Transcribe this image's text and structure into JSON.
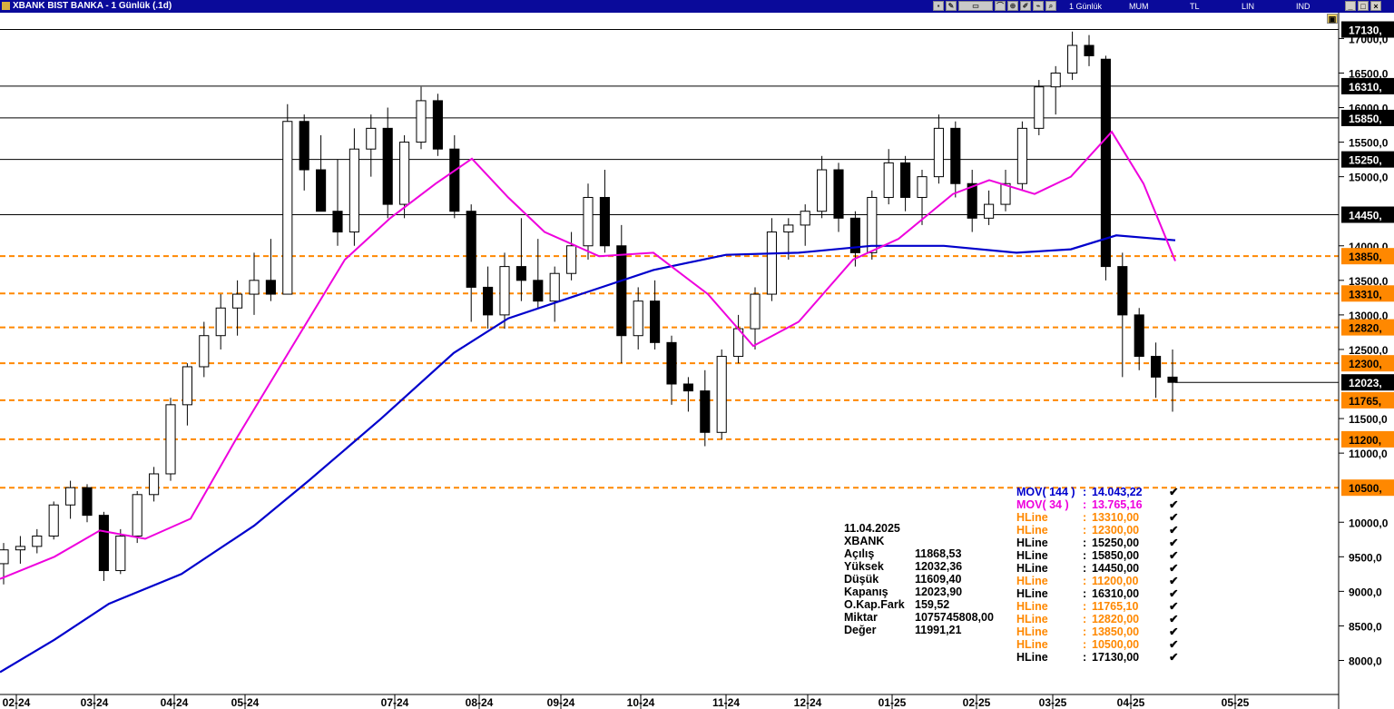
{
  "window": {
    "title": "XBANK BIST BANKA - 1 Günlük (.1d)",
    "toolbar": {
      "period": "1 Günlük",
      "mode": "MUM",
      "currency": "TL",
      "scale": "LIN",
      "indicator": "IND"
    }
  },
  "chart_data": {
    "type": "candlestick",
    "symbol": "XBANK",
    "x_ticks": [
      "02-24",
      "03-24",
      "04-24",
      "05-24",
      "07-24",
      "08-24",
      "09-24",
      "10-24",
      "11-24",
      "12-24",
      "01-25",
      "02-25",
      "03-25",
      "04-25",
      "05-25"
    ],
    "y_ticks": [
      "17000,0",
      "16500,0",
      "16000,0",
      "15500,0",
      "15000,0",
      "14000,0",
      "13500,0",
      "13000,0",
      "12500,0",
      "11500,0",
      "11000,0",
      "10000,0",
      "9500,0",
      "9000,0",
      "8500,0",
      "8000,0"
    ],
    "ylim": [
      7700,
      17400
    ],
    "ohlc_daily_approx": [
      [
        9400,
        9700,
        9100,
        9600
      ],
      [
        9600,
        9800,
        9400,
        9650
      ],
      [
        9650,
        9900,
        9550,
        9800
      ],
      [
        9800,
        10300,
        9750,
        10250
      ],
      [
        10250,
        10600,
        10050,
        10500
      ],
      [
        10500,
        10550,
        10000,
        10100
      ],
      [
        10100,
        10150,
        9150,
        9300
      ],
      [
        9300,
        9900,
        9250,
        9800
      ],
      [
        9800,
        10450,
        9700,
        10400
      ],
      [
        10400,
        10800,
        10300,
        10700
      ],
      [
        10700,
        11800,
        10600,
        11700
      ],
      [
        11700,
        12300,
        11400,
        12250
      ],
      [
        12250,
        12900,
        12100,
        12700
      ],
      [
        12700,
        13300,
        12500,
        13100
      ],
      [
        13100,
        13500,
        12700,
        13300
      ],
      [
        13300,
        13900,
        13000,
        13500
      ],
      [
        13500,
        14100,
        13200,
        13300
      ],
      [
        13300,
        16050,
        13300,
        15800
      ],
      [
        15800,
        15900,
        14800,
        15100
      ],
      [
        15100,
        15600,
        14600,
        14500
      ],
      [
        14500,
        15250,
        14000,
        14200
      ],
      [
        14200,
        15700,
        14000,
        15400
      ],
      [
        15400,
        15900,
        15000,
        15700
      ],
      [
        15700,
        16000,
        14400,
        14600
      ],
      [
        14600,
        15600,
        14400,
        15500
      ],
      [
        15500,
        16300,
        15400,
        16100
      ],
      [
        16100,
        16200,
        15300,
        15400
      ],
      [
        15400,
        15600,
        14400,
        14500
      ],
      [
        14500,
        14600,
        12900,
        13400
      ],
      [
        13400,
        13700,
        12800,
        13000
      ],
      [
        13000,
        13900,
        12800,
        13700
      ],
      [
        13700,
        14400,
        13200,
        13500
      ],
      [
        13500,
        14100,
        13100,
        13200
      ],
      [
        13200,
        13700,
        12900,
        13600
      ],
      [
        13600,
        14200,
        13500,
        14000
      ],
      [
        14000,
        14900,
        13800,
        14700
      ],
      [
        14700,
        15100,
        13900,
        14000
      ],
      [
        14000,
        14300,
        12300,
        12700
      ],
      [
        12700,
        13400,
        12500,
        13200
      ],
      [
        13200,
        13500,
        12500,
        12600
      ],
      [
        12600,
        12700,
        11700,
        12000
      ],
      [
        12000,
        12100,
        11600,
        11900
      ],
      [
        11900,
        12200,
        11100,
        11300
      ],
      [
        11300,
        12500,
        11200,
        12400
      ],
      [
        12400,
        13000,
        12300,
        12800
      ],
      [
        12800,
        13400,
        12500,
        13300
      ],
      [
        13300,
        14400,
        13200,
        14200
      ],
      [
        14200,
        14400,
        13800,
        14300
      ],
      [
        14300,
        14600,
        14000,
        14500
      ],
      [
        14500,
        15300,
        14400,
        15100
      ],
      [
        15100,
        15200,
        14200,
        14400
      ],
      [
        14400,
        14500,
        13700,
        13900
      ],
      [
        13900,
        14800,
        13800,
        14700
      ],
      [
        14700,
        15400,
        14600,
        15200
      ],
      [
        15200,
        15300,
        14500,
        14700
      ],
      [
        14700,
        15100,
        14300,
        15000
      ],
      [
        15000,
        15900,
        14900,
        15700
      ],
      [
        15700,
        15800,
        14700,
        14900
      ],
      [
        14900,
        15100,
        14200,
        14400
      ],
      [
        14400,
        14800,
        14300,
        14600
      ],
      [
        14600,
        15100,
        14500,
        14900
      ],
      [
        14900,
        15800,
        14800,
        15700
      ],
      [
        15700,
        16400,
        15600,
        16300
      ],
      [
        16300,
        16600,
        15900,
        16500
      ],
      [
        16500,
        17100,
        16400,
        16900
      ],
      [
        16900,
        17050,
        16600,
        16750
      ],
      [
        16700,
        16750,
        13500,
        13700
      ],
      [
        13700,
        13900,
        12100,
        13000
      ],
      [
        13000,
        13100,
        12200,
        12400
      ],
      [
        12400,
        12600,
        11800,
        12100
      ],
      [
        12100,
        12500,
        11600,
        12024
      ]
    ],
    "close_last": "12023,",
    "moving_averages": [
      {
        "name": "MOV( 144 )",
        "value": "14.043,22",
        "color": "#0000cc"
      },
      {
        "name": "MOV( 34 )",
        "value": "13.765,16",
        "color": "#ee00dd"
      }
    ],
    "ma144_approx": [
      [
        0,
        7830
      ],
      [
        60,
        8300
      ],
      [
        120,
        8820
      ],
      [
        200,
        9250
      ],
      [
        280,
        9950
      ],
      [
        340,
        10600
      ],
      [
        420,
        11500
      ],
      [
        500,
        12450
      ],
      [
        560,
        12950
      ],
      [
        640,
        13300
      ],
      [
        720,
        13650
      ],
      [
        800,
        13870
      ],
      [
        880,
        13900
      ],
      [
        960,
        14000
      ],
      [
        1040,
        14000
      ],
      [
        1120,
        13900
      ],
      [
        1180,
        13950
      ],
      [
        1230,
        14150
      ],
      [
        1295,
        14080
      ]
    ],
    "ma34_approx": [
      [
        0,
        9180
      ],
      [
        60,
        9500
      ],
      [
        110,
        9880
      ],
      [
        160,
        9760
      ],
      [
        210,
        10050
      ],
      [
        260,
        11200
      ],
      [
        320,
        12500
      ],
      [
        380,
        13800
      ],
      [
        430,
        14400
      ],
      [
        480,
        14900
      ],
      [
        520,
        15260
      ],
      [
        560,
        14700
      ],
      [
        600,
        14200
      ],
      [
        660,
        13850
      ],
      [
        720,
        13900
      ],
      [
        780,
        13300
      ],
      [
        830,
        12550
      ],
      [
        880,
        12900
      ],
      [
        940,
        13800
      ],
      [
        990,
        14100
      ],
      [
        1050,
        14750
      ],
      [
        1090,
        14950
      ],
      [
        1140,
        14750
      ],
      [
        1180,
        15000
      ],
      [
        1225,
        15650
      ],
      [
        1260,
        14900
      ],
      [
        1295,
        13780
      ]
    ],
    "hlines": [
      {
        "label": "HLine",
        "value": "13310,00",
        "box": "13310,",
        "color": "#ff8800",
        "style": "dashed"
      },
      {
        "label": "HLine",
        "value": "12300,00",
        "box": "12300,",
        "color": "#ff8800",
        "style": "dashed"
      },
      {
        "label": "HLine",
        "value": "15250,00",
        "box": "15250,",
        "color": "#000000",
        "style": "solid"
      },
      {
        "label": "HLine",
        "value": "15850,00",
        "box": "15850,",
        "color": "#000000",
        "style": "solid"
      },
      {
        "label": "HLine",
        "value": "14450,00",
        "box": "14450,",
        "color": "#000000",
        "style": "solid"
      },
      {
        "label": "HLine",
        "value": "11200,00",
        "box": "11200,",
        "color": "#ff8800",
        "style": "dashed"
      },
      {
        "label": "HLine",
        "value": "16310,00",
        "box": "16310,",
        "color": "#000000",
        "style": "solid"
      },
      {
        "label": "HLine",
        "value": "11765,10",
        "box": "11765,",
        "color": "#ff8800",
        "style": "dashed"
      },
      {
        "label": "HLine",
        "value": "12820,00",
        "box": "12820,",
        "color": "#ff8800",
        "style": "dashed"
      },
      {
        "label": "HLine",
        "value": "13850,00",
        "box": "13850,",
        "color": "#ff8800",
        "style": "dashed"
      },
      {
        "label": "HLine",
        "value": "10500,00",
        "box": "10500,",
        "color": "#ff8800",
        "style": "dashed"
      },
      {
        "label": "HLine",
        "value": "17130,00",
        "box": "17130,",
        "color": "#000000",
        "style": "solid"
      }
    ],
    "info": {
      "date": "11.04.2025",
      "symbol": "XBANK",
      "rows": [
        {
          "k": "Açılış",
          "v": "11868,53"
        },
        {
          "k": "Yüksek",
          "v": "12032,36"
        },
        {
          "k": "Düşük",
          "v": "11609,40"
        },
        {
          "k": "Kapanış",
          "v": "12023,90"
        },
        {
          "k": "O.Kap.Fark",
          "v": "159,52"
        },
        {
          "k": "Miktar",
          "v": "1075745808,00"
        },
        {
          "k": "Değer",
          "v": "11991,21"
        }
      ]
    },
    "legend_sep": ":",
    "check_mark": "✔"
  }
}
